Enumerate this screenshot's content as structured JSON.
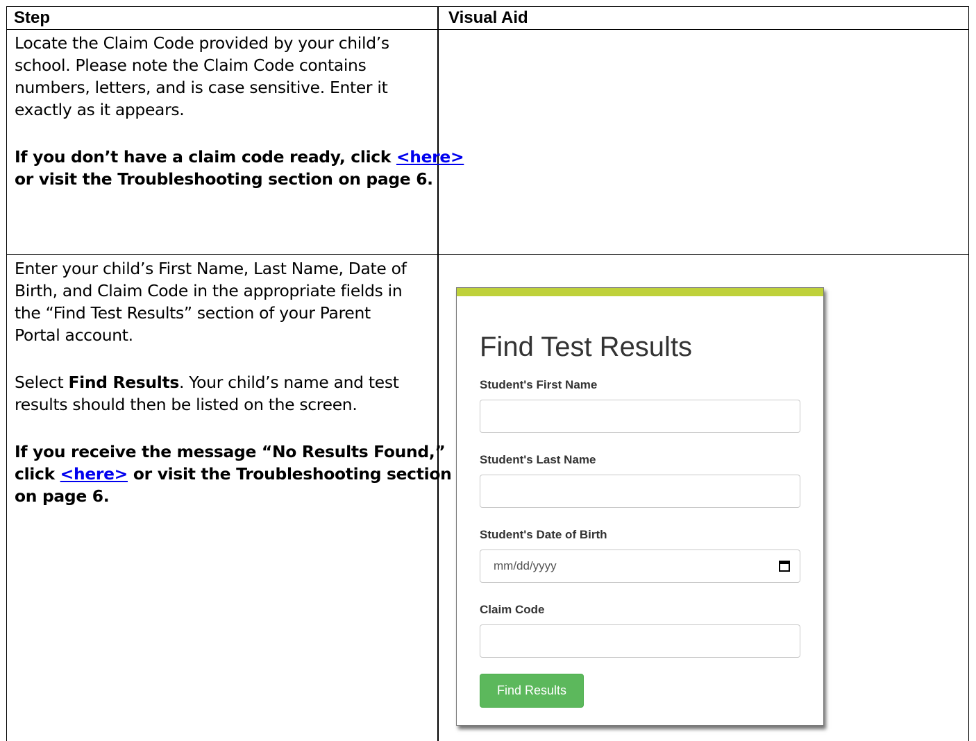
{
  "table": {
    "headers": {
      "step": "Step",
      "visual_aid": "Visual Aid"
    },
    "row1": {
      "para1": [
        "Locate the Claim Code provided by your child’s",
        "school. Please note the Claim Code contains",
        "numbers, letters, and is case sensitive. Enter it",
        "exactly as it appears."
      ],
      "note_line1_prefix": "If you don’t have a claim code ready, click ",
      "note_link": "<here>",
      "note_line2": "or visit the Troubleshooting section on page 6."
    },
    "row2": {
      "para1": [
        "Enter your child’s First Name, Last Name, Date of",
        "Birth, and Claim Code in the appropriate fields in",
        "the “Find Test Results” section of your Parent",
        "Portal account."
      ],
      "select_prefix": "Select ",
      "select_bold": "Find Results",
      "select_rest": ". Your child’s name and test",
      "select_line2": "results should then be listed on the screen.",
      "note_line1": "If you receive the message “No Results Found,”",
      "note_line2_prefix": "click ",
      "note_link": "<here>",
      "note_line2_suffix": " or visit the Troubleshooting section",
      "note_line3": "on page 6."
    }
  },
  "visual_aid": {
    "title": "Find Test Results",
    "accent_color": "#bfd13a",
    "fields": [
      {
        "label": "Student's First Name",
        "placeholder": ""
      },
      {
        "label": "Student's Last Name",
        "placeholder": ""
      },
      {
        "label": "Student's Date of Birth",
        "placeholder": "mm/dd/yyyy",
        "icon": "calendar-icon"
      },
      {
        "label": "Claim Code",
        "placeholder": ""
      }
    ],
    "button_label": "Find Results",
    "button_color": "#5cb85c"
  }
}
